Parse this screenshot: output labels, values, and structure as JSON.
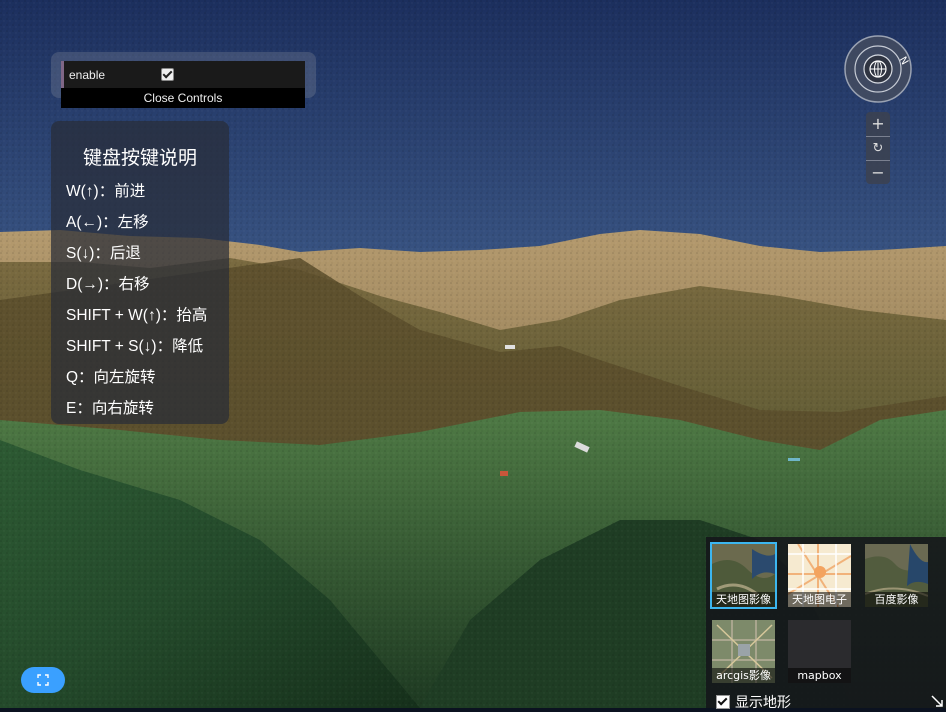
{
  "gui": {
    "enable_label": "enable",
    "enable_checked": true,
    "close_label": "Close Controls"
  },
  "help": {
    "title": "键盘按键说明",
    "items": [
      "W(↑)：前进",
      "A(←)：左移",
      "S(↓)：后退",
      "D(→)：右移",
      "SHIFT + W(↑)：抬高",
      "SHIFT + S(↓)：降低",
      "Q：向左旋转",
      "E：向右旋转"
    ]
  },
  "navigation": {
    "compass_letter": "N",
    "zoom_in": "+",
    "reset": "↻",
    "zoom_out": "−"
  },
  "basemaps": {
    "items": [
      {
        "label": "天地图影像",
        "selected": true
      },
      {
        "label": "天地图电子",
        "selected": false
      },
      {
        "label": "百度影像",
        "selected": false
      },
      {
        "label": "arcgis影像",
        "selected": false
      },
      {
        "label": "mapbox",
        "selected": false
      }
    ],
    "terrain_label": "显示地形",
    "terrain_checked": true
  },
  "colors": {
    "sky_top": "#1f3566",
    "sky_bottom": "#5f7fa6",
    "accent_blue": "#3aa0ff",
    "selected_outline": "#3cb6f0"
  }
}
